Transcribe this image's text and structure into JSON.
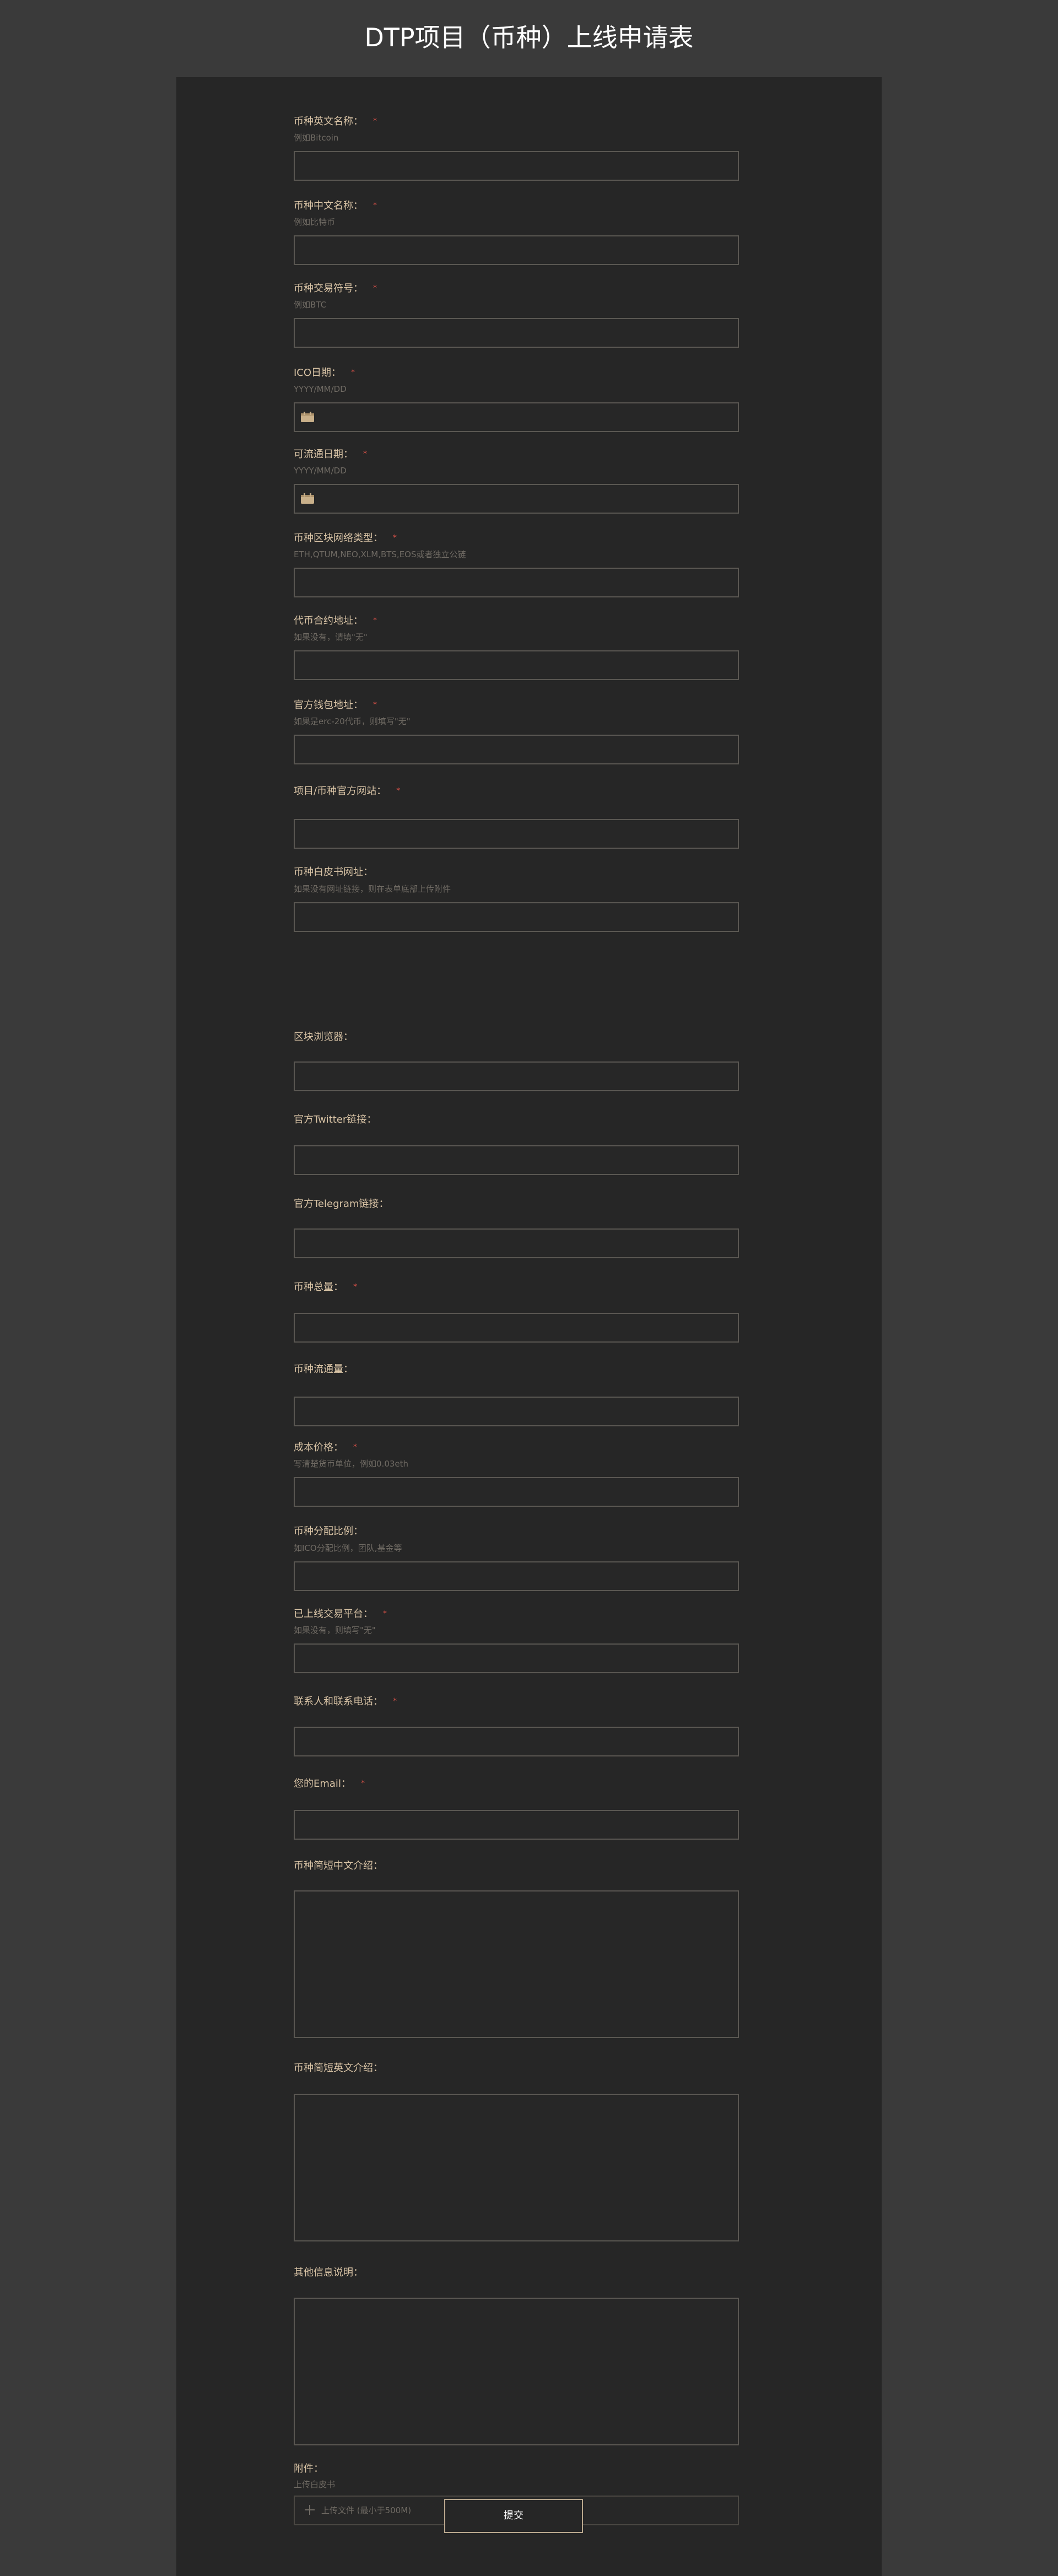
{
  "page": {
    "title": "DTP项目（币种）上线申请表"
  },
  "fields": {
    "name_en": {
      "label": "币种英文名称：",
      "required": "*",
      "hint": "例如Bitcoin"
    },
    "name_cn": {
      "label": "币种中文名称：",
      "required": "*",
      "hint": "例如比特币"
    },
    "symbol": {
      "label": "币种交易符号：",
      "required": "*",
      "hint": "例如BTC"
    },
    "ico_date": {
      "label": "ICO日期：",
      "required": "*",
      "hint": "YYYY/MM/DD",
      "icon": "calendar-icon"
    },
    "circ_date": {
      "label": "可流通日期：",
      "required": "*",
      "hint": "YYYY/MM/DD",
      "icon": "calendar-icon"
    },
    "chain_type": {
      "label": "币种区块网络类型：",
      "required": "*",
      "hint": "ETH,QTUM,NEO,XLM,BTS,EOS或者独立公链"
    },
    "contract": {
      "label": "代币合约地址：",
      "required": "*",
      "hint": "如果没有，请填\"无\""
    },
    "wallet": {
      "label": "官方钱包地址：",
      "required": "*",
      "hint": "如果是erc-20代币，则填写\"无\""
    },
    "website": {
      "label": "项目/币种官方网站：",
      "required": "*"
    },
    "whitepaper": {
      "label": "币种白皮书网址：",
      "hint": "如果没有网址链接，则在表单底部上传附件"
    },
    "explorer": {
      "label": "区块浏览器："
    },
    "twitter": {
      "label": "官方Twitter链接："
    },
    "telegram": {
      "label": "官方Telegram链接："
    },
    "total": {
      "label": "币种总量：",
      "required": "*"
    },
    "circulating": {
      "label": "币种流通量："
    },
    "cost": {
      "label": "成本价格：",
      "required": "*",
      "hint": "写清楚货币单位，例如0.03eth"
    },
    "distribution": {
      "label": "币种分配比例：",
      "hint": "如ICO分配比例，团队,基金等"
    },
    "exchanges": {
      "label": "已上线交易平台：",
      "required": "*",
      "hint": "如果没有，则填写\"无\""
    },
    "contact": {
      "label": "联系人和联系电话：",
      "required": "*"
    },
    "email": {
      "label": "您的Email：",
      "required": "*"
    },
    "intro_cn": {
      "label": "币种简短中文介绍："
    },
    "intro_en": {
      "label": "币种简短英文介绍："
    },
    "other": {
      "label": "其他信息说明："
    },
    "attachment": {
      "label": "附件：",
      "hint": "上传白皮书",
      "upload_text": "上传文件 (最小于500M)",
      "icon": "plus-icon"
    }
  },
  "submit": {
    "label": "提交"
  },
  "colors": {
    "page_bg": "#3a3a3a",
    "panel_bg": "#262626",
    "label": "#d8c3a5",
    "hint": "#6f6a63",
    "required": "#e0534a",
    "input_border": "#5a5752",
    "title": "#ffffff"
  }
}
